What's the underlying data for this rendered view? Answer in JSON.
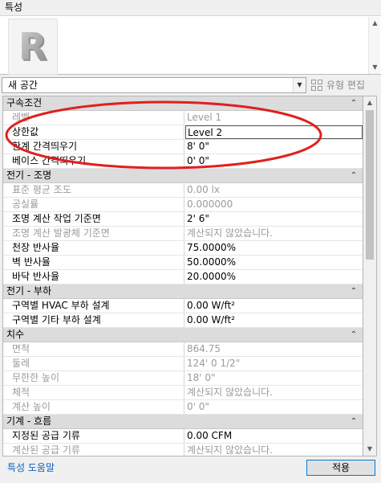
{
  "panel": {
    "title": "특성"
  },
  "type_selector": {
    "logo_letter": "R",
    "value": "새 공간",
    "edit_type_label": "유형 편집"
  },
  "categories": [
    {
      "title": "구속조건",
      "properties": [
        {
          "label": "레벨",
          "value": "Level 1",
          "enabled": false
        },
        {
          "label": "상한값",
          "value": "Level 2",
          "enabled": true,
          "selected": true
        },
        {
          "label": "한계 간격띄우기",
          "value": "8'  0\"",
          "enabled": true
        },
        {
          "label": "베이스 간격띄우기",
          "value": "0'  0\"",
          "enabled": true
        }
      ]
    },
    {
      "title": "전기 - 조명",
      "properties": [
        {
          "label": "표준 평균 조도",
          "value": "0.00 lx",
          "enabled": false
        },
        {
          "label": "공실률",
          "value": "0.000000",
          "enabled": false
        },
        {
          "label": "조명 계산 작업 기준면",
          "value": "2'  6\"",
          "enabled": true
        },
        {
          "label": "조명 계산 발광체 기준면",
          "value": "계산되지 않았습니다.",
          "enabled": false
        },
        {
          "label": "천장 반사율",
          "value": "75.0000%",
          "enabled": true
        },
        {
          "label": "벽 반사율",
          "value": "50.0000%",
          "enabled": true
        },
        {
          "label": "바닥 반사율",
          "value": "20.0000%",
          "enabled": true
        }
      ]
    },
    {
      "title": "전기 - 부하",
      "properties": [
        {
          "label": "구역별 HVAC 부하 설계",
          "value": "0.00 W/ft²",
          "enabled": true
        },
        {
          "label": "구역별 기타 부하 설계",
          "value": "0.00 W/ft²",
          "enabled": true
        }
      ]
    },
    {
      "title": "치수",
      "properties": [
        {
          "label": "면적",
          "value": "864.75",
          "enabled": false
        },
        {
          "label": "둘레",
          "value": "124'  0 1/2\"",
          "enabled": false
        },
        {
          "label": "무한한 높이",
          "value": "18'  0\"",
          "enabled": false
        },
        {
          "label": "체적",
          "value": "계산되지 않았습니다.",
          "enabled": false
        },
        {
          "label": "계산 높이",
          "value": "0'  0\"",
          "enabled": false
        }
      ]
    },
    {
      "title": "기계 - 흐름",
      "properties": [
        {
          "label": "지정된 공급 기류",
          "value": "0.00 CFM",
          "enabled": true
        },
        {
          "label": "계산된 공급 기류",
          "value": "계산되지 않았습니다.",
          "enabled": false
        },
        {
          "label": "",
          "value": "",
          "enabled": false
        }
      ]
    }
  ],
  "footer": {
    "help_link": "특성 도움말",
    "apply_label": "적용"
  },
  "colors": {
    "annotation": "#e0201e",
    "link": "#0a5fc0",
    "disabled_text": "#9b9b9b",
    "category_bg": "#dcdcdc"
  }
}
